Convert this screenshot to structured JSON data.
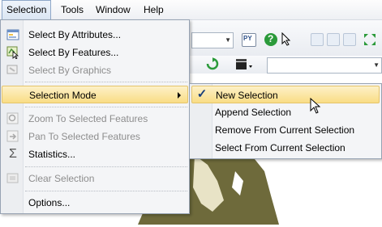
{
  "menubar": {
    "items": [
      {
        "label": "Selection"
      },
      {
        "label": "Tools"
      },
      {
        "label": "Window"
      },
      {
        "label": "Help"
      }
    ]
  },
  "menu": {
    "items": [
      {
        "label": "Select By Attributes...",
        "icon": "select-by-attributes-icon",
        "enabled": true
      },
      {
        "label": "Select By Features...",
        "icon": "select-by-features-icon",
        "enabled": true
      },
      {
        "label": "Select By Graphics",
        "icon": "select-by-graphics-icon",
        "enabled": false
      },
      {
        "label": "Selection Mode",
        "enabled": true,
        "submenu": true,
        "highlighted": true
      },
      {
        "label": "Zoom To Selected Features",
        "icon": "zoom-to-selected-icon",
        "enabled": false
      },
      {
        "label": "Pan To Selected Features",
        "icon": "pan-to-selected-icon",
        "enabled": false
      },
      {
        "label": "Statistics...",
        "icon": "sigma-icon",
        "enabled": true
      },
      {
        "label": "Clear Selection",
        "icon": "clear-selection-icon",
        "enabled": false
      },
      {
        "label": "Options...",
        "enabled": true
      }
    ]
  },
  "submenu": {
    "items": [
      {
        "label": "New Selection",
        "checked": true,
        "highlighted": true
      },
      {
        "label": "Append Selection"
      },
      {
        "label": "Remove From Current Selection"
      },
      {
        "label": "Select From Current Selection"
      }
    ]
  },
  "toolbar": {
    "python_label": "PY"
  },
  "colors": {
    "highlight_top": "#fdf1c8",
    "highlight_bottom": "#f9dd85",
    "map_land": "#6e6a3b",
    "check": "#1a3f7a"
  }
}
